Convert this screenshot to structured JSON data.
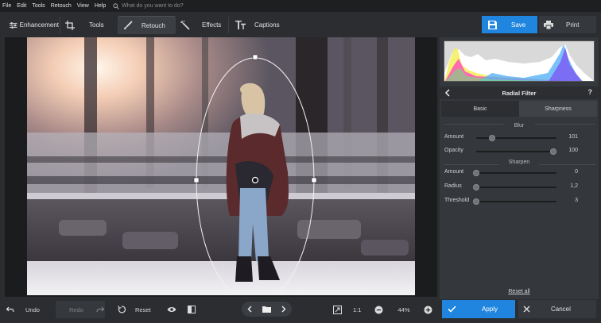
{
  "menu": {
    "items": [
      "File",
      "Edit",
      "Tools",
      "Retouch",
      "View",
      "Help"
    ],
    "search_placeholder": "What do you want to do?"
  },
  "toolbar": {
    "tabs": [
      {
        "label": "Enhancement",
        "icon": "sliders-icon"
      },
      {
        "label": "Tools",
        "icon": "crop-icon"
      },
      {
        "label": "Retouch",
        "icon": "brush-icon",
        "active": true
      },
      {
        "label": "Effects",
        "icon": "magic-wand-icon"
      },
      {
        "label": "Captions",
        "icon": "text-icon"
      }
    ],
    "save_label": "Save",
    "print_label": "Print"
  },
  "panel": {
    "title": "Radial Filter",
    "help": "?",
    "tabs": [
      "Basic",
      "Sharpness"
    ],
    "active_tab": "Sharpness",
    "blur": {
      "title": "Blur",
      "sliders": [
        {
          "label": "Amount",
          "value": "101",
          "fraction": 0.2
        },
        {
          "label": "Opacity",
          "value": "100",
          "fraction": 0.96
        }
      ]
    },
    "sharpen": {
      "title": "Sharpen",
      "sliders": [
        {
          "label": "Amount",
          "value": "0",
          "fraction": 0.0
        },
        {
          "label": "Radius",
          "value": "1,2",
          "fraction": 0.0
        },
        {
          "label": "Threshold",
          "value": "3",
          "fraction": 0.0
        }
      ]
    },
    "reset_all": "Reset all"
  },
  "bottom": {
    "undo_label": "Undo",
    "redo_label": "Redo",
    "reset_label": "Reset",
    "zoom_1to1": "1:1",
    "zoom_level": "44%",
    "apply_label": "Apply",
    "cancel_label": "Cancel"
  },
  "colors": {
    "accent": "#1f85de",
    "background": "#2b2d30",
    "panel": "#34373b"
  }
}
